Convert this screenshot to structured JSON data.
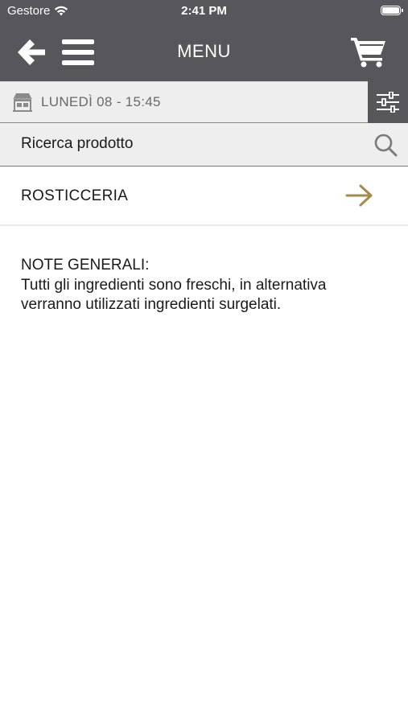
{
  "status_bar": {
    "carrier": "Gestore",
    "time": "2:41 PM",
    "icons": [
      "wifi-icon",
      "battery-icon"
    ]
  },
  "nav": {
    "title": "MENU",
    "icons": [
      "arrow-left-icon",
      "hamburger-icon",
      "cart-icon"
    ]
  },
  "delivery": {
    "slot": "LUNEDÌ 08 - 15:45",
    "icons": [
      "shop-icon",
      "sliders-icon"
    ]
  },
  "search": {
    "placeholder": "Ricerca prodotto",
    "value": "",
    "icon": "search-icon"
  },
  "categories": [
    {
      "label": "ROSTICCERIA",
      "icon": "arrow-right-icon"
    }
  ],
  "notes": {
    "heading": "NOTE GENERALI:",
    "line1": "Tutti gli ingredienti sono freschi, in alternativa",
    "line2": "verranno utilizzati ingredienti surgelati."
  },
  "colors": {
    "header_bg": "#56565b",
    "bar_bg": "#eeeeee",
    "accent": "#a68a4c",
    "text": "#1a1a1a",
    "muted": "#6a6a6a"
  }
}
